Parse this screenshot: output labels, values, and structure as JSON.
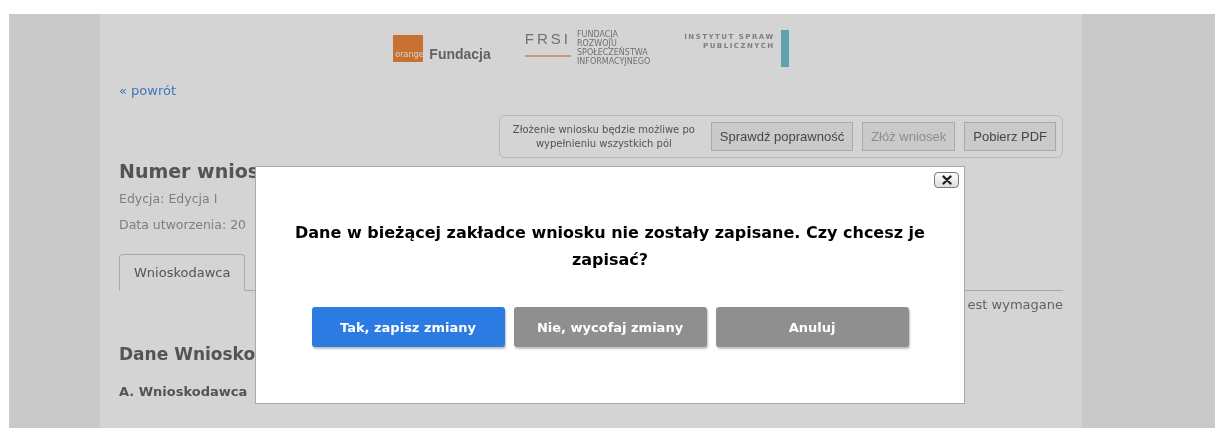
{
  "logos": {
    "orange_badge": "orange",
    "orange_name": "Fundacja",
    "frsi_mark": "FRSI",
    "frsi_name": [
      "FUNDACJA",
      "ROZWOJU",
      "SPOŁECZEŃSTWA",
      "INFORMACYJNEGO"
    ],
    "isp_name": [
      "INSTYTUT SPRAW",
      "PUBLICZNYCH"
    ]
  },
  "back_link": "« powrót",
  "actions": {
    "note": "Złożenie wniosku będzie możliwe po wypełnieniu wszystkich pól",
    "buttons": [
      {
        "label": "Sprawdź poprawność",
        "disabled": false
      },
      {
        "label": "Złóż wniosek",
        "disabled": true
      },
      {
        "label": "Pobierz PDF",
        "disabled": false
      }
    ]
  },
  "heading": "Numer wnios",
  "meta": [
    "Edycja: Edycja I",
    "Data utworzenia: 20"
  ],
  "tabs": [
    {
      "label": "Wnioskodawca",
      "selected": true
    }
  ],
  "required_note": "est wymagane",
  "section_title": "Dane Wniosko",
  "subsection_title": "A. Wnioskodawca",
  "dialog": {
    "message": "Dane w bieżącej zakładce wniosku nie zostały zapisane. Czy chcesz je zapisać?",
    "buttons": [
      {
        "label": "Tak, zapisz zmiany",
        "kind": "primary"
      },
      {
        "label": "Nie, wycofaj zmiany",
        "kind": "secondary"
      },
      {
        "label": "Anuluj",
        "kind": "secondary"
      }
    ]
  }
}
